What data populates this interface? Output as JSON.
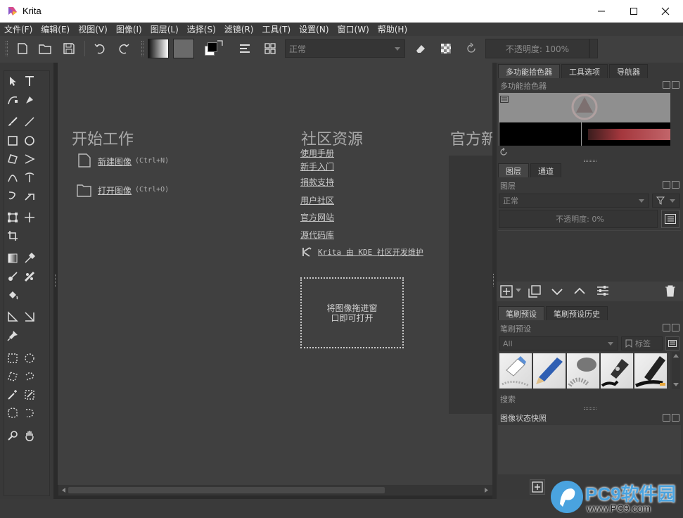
{
  "window": {
    "title": "Krita",
    "minimize_icon": "minimize-icon",
    "maximize_icon": "maximize-icon",
    "close_icon": "close-icon"
  },
  "menu": [
    "文件(F)",
    "编辑(E)",
    "视图(V)",
    "图像(I)",
    "图层(L)",
    "选择(S)",
    "滤镜(R)",
    "工具(T)",
    "设置(N)",
    "窗口(W)",
    "帮助(H)"
  ],
  "toolbar": {
    "blend_mode": "正常",
    "opacity_label": "不透明度: 100%"
  },
  "welcome": {
    "start_heading": "开始工作",
    "new_image": "新建图像",
    "new_image_shortcut": "(Ctrl+N)",
    "open_image": "打开图像",
    "open_image_shortcut": "(Ctrl+O)",
    "community_heading": "社区资源",
    "community_links": [
      "使用手册",
      "新手入门",
      "捐款支持",
      "用户社区",
      "官方网站",
      "源代码库"
    ],
    "kde_text": "Krita 由 KDE 社区开发维护",
    "drop_line1": "将图像拖进窗",
    "drop_line2": "口即可打开",
    "news_heading": "官方新"
  },
  "docker": {
    "top_tabs": [
      "多功能拾色器",
      "工具选项",
      "导航器"
    ],
    "color_selector_title": "多功能拾色器",
    "layer_tabs": [
      "图层",
      "通道"
    ],
    "layers_title": "图层",
    "layers_blend": "正常",
    "layers_opacity": "不透明度:  0%",
    "brush_tabs": [
      "笔刷预设",
      "笔刷预设历史"
    ],
    "brush_title": "笔刷预设",
    "brush_filter": "All",
    "brush_tag": "标签",
    "brush_search": "搜索",
    "snapshot_title": "图像状态快照"
  },
  "watermark": {
    "brand": "PC9软件园",
    "url": "www.PC9.com"
  },
  "colors": {
    "accent": "#4aa3df",
    "canvas": "#404040",
    "panel": "#393939"
  }
}
